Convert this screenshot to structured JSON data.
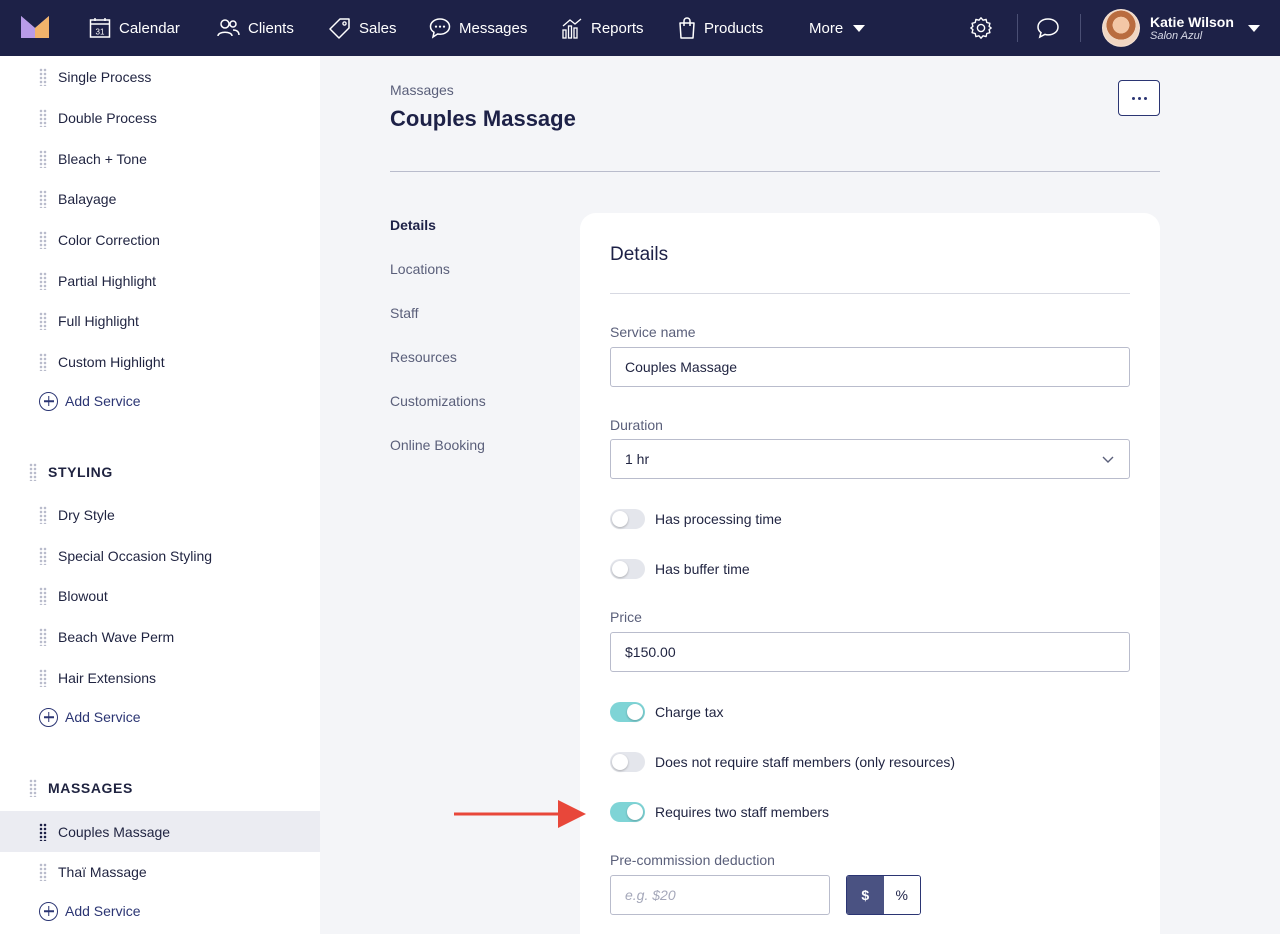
{
  "nav": {
    "items": [
      {
        "label": "Calendar",
        "icon": "calendar-icon"
      },
      {
        "label": "Clients",
        "icon": "clients-icon"
      },
      {
        "label": "Sales",
        "icon": "tag-icon"
      },
      {
        "label": "Messages",
        "icon": "chat-bubble-icon"
      },
      {
        "label": "Reports",
        "icon": "bar-chart-icon"
      },
      {
        "label": "Products",
        "icon": "shopping-bag-icon"
      },
      {
        "label": "More",
        "icon": "caret-down-icon"
      }
    ],
    "calendar_day": "31",
    "user": {
      "name": "Katie Wilson",
      "salon": "Salon Azul"
    },
    "colors": {
      "background": "#1d2147",
      "text": "#ffffff"
    }
  },
  "sidebar": {
    "hair_services": [
      "Single Process",
      "Double Process",
      "Bleach + Tone",
      "Balayage",
      "Color Correction",
      "Partial Highlight",
      "Full Highlight",
      "Custom Highlight"
    ],
    "add_service_label": "Add Service",
    "categories": [
      {
        "name": "STYLING",
        "services": [
          "Dry Style",
          "Special Occasion Styling",
          "Blowout",
          "Beach Wave Perm",
          "Hair Extensions"
        ]
      },
      {
        "name": "MASSAGES",
        "services": [
          "Couples Massage",
          "Thaï Massage"
        ]
      }
    ],
    "active_service": "Couples Massage"
  },
  "header": {
    "breadcrumb": "Massages",
    "title": "Couples Massage"
  },
  "subnav": [
    "Details",
    "Locations",
    "Staff",
    "Resources",
    "Customizations",
    "Online Booking"
  ],
  "details": {
    "title": "Details",
    "service_name_label": "Service name",
    "service_name_value": "Couples Massage",
    "duration_label": "Duration",
    "duration_value": "1 hr",
    "price_label": "Price",
    "price_value": "$150.00",
    "toggles": [
      {
        "label": "Has processing time",
        "on": false
      },
      {
        "label": "Has buffer time",
        "on": false
      },
      {
        "label": "Charge tax",
        "on": true
      },
      {
        "label": "Does not require staff members (only resources)",
        "on": false
      },
      {
        "label": "Requires two staff members",
        "on": true
      }
    ],
    "deduction_label": "Pre-commission deduction",
    "deduction_placeholder": "e.g. $20",
    "deduction_units": [
      "$",
      "%"
    ],
    "deduction_unit_selected": "$"
  },
  "colors": {
    "accent": "#2b3573",
    "toggle_on": "#7fd4d6",
    "annotation_arrow": "#e8473a"
  }
}
